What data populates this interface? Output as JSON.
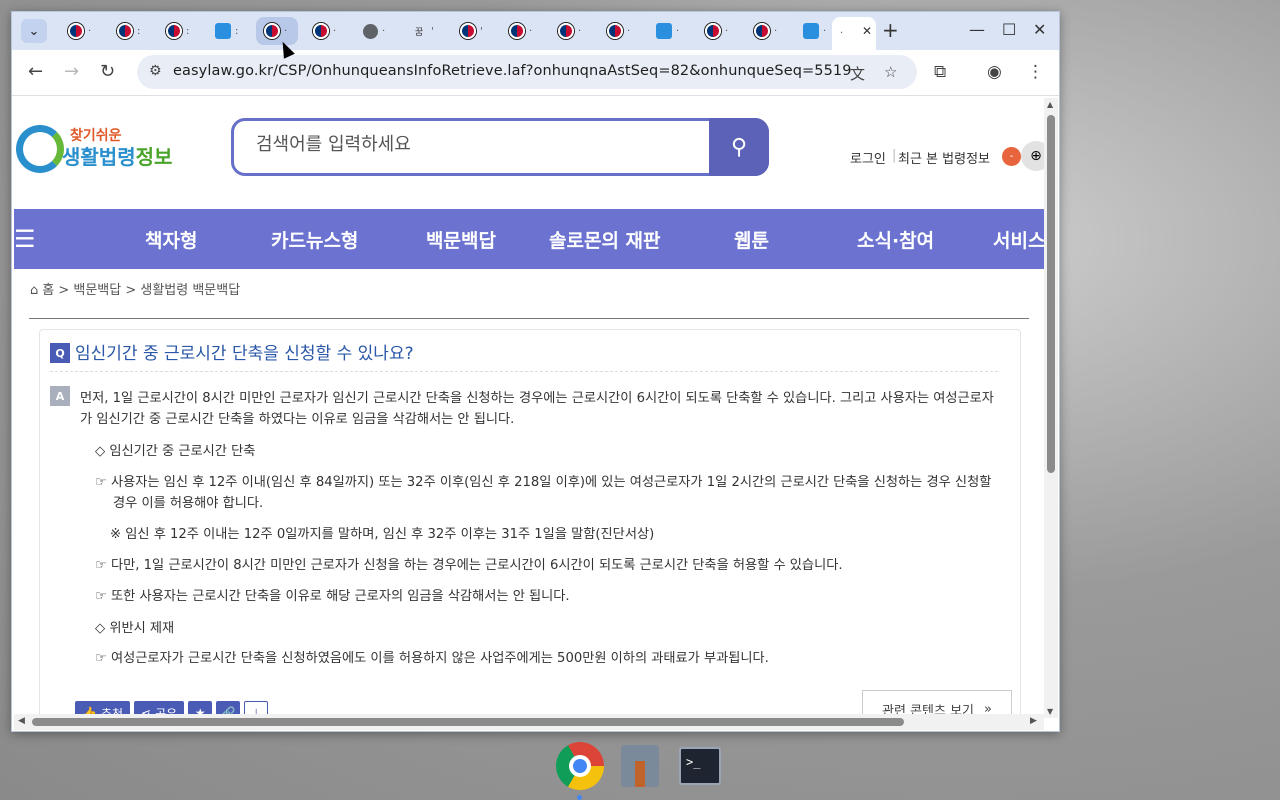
{
  "browser": {
    "tabs": [
      {
        "favicon": "korea-gov-icon",
        "dot": "·"
      },
      {
        "favicon": "korea-gov-icon",
        "dot": ":"
      },
      {
        "favicon": "korea-gov-icon",
        "dot": ":"
      },
      {
        "favicon": "easylaw-box-icon",
        "dot": ":"
      },
      {
        "favicon": "korea-gov-icon",
        "dot": "·"
      },
      {
        "favicon": "korea-gov-icon",
        "dot": "·"
      },
      {
        "favicon": "globe-icon",
        "dot": "·"
      },
      {
        "favicon": "text-favicon",
        "dot": "'"
      },
      {
        "favicon": "korea-gov-icon",
        "dot": "'"
      },
      {
        "favicon": "korea-gov-icon",
        "dot": "·"
      },
      {
        "favicon": "korea-gov-icon",
        "dot": "·"
      },
      {
        "favicon": "korea-gov-icon",
        "dot": "·"
      },
      {
        "favicon": "easylaw-box-icon",
        "dot": "·"
      },
      {
        "favicon": "korea-gov-icon",
        "dot": "·"
      },
      {
        "favicon": "korea-gov-icon",
        "dot": "·"
      },
      {
        "favicon": "easylaw-box-icon",
        "dot": "·"
      }
    ],
    "tab_glyph": "꿈",
    "active_tab_dot": "·",
    "close_glyph": "✕",
    "newtab_glyph": "+",
    "url": "easylaw.go.kr/CSP/OnhunqueansInfoRetrieve.laf?onhunqnaAstSeq=82&onhunqueSeq=5519"
  },
  "site": {
    "logo_top": "찾기쉬운",
    "logo_main_a": "생활법령",
    "logo_main_b": "정보",
    "search_placeholder": "검색어를 입력하세요",
    "login": "로그인",
    "recent": "최근 본 법령정보",
    "recent_badge": "-",
    "menu": [
      "책자형",
      "카드뉴스형",
      "백문백답",
      "솔로몬의 재판",
      "웹툰",
      "소식·참여",
      "서비스"
    ],
    "breadcrumb": "홈 > 백문백답 > 생활법령 백문백답"
  },
  "qa": {
    "q_label": "Q",
    "question": "임신기간 중 근로시간 단축을 신청할 수 있나요?",
    "a_label": "A",
    "answer": "먼저, 1일 근로시간이 8시간 미만인 근로자가 임신기 근로시간 단축을 신청하는 경우에는 근로시간이 6시간이 되도록 단축할 수 있습니다. 그리고 사용자는 여성근로자가 임신기간 중 근로시간 단축을 하였다는 이유로 임금을 삭감해서는 안 됩니다.",
    "section1": "◇ 임신기간 중 근로시간 단축",
    "item1": "☞ 사용자는 임신 후 12주 이내(임신 후 84일까지) 또는 32주 이후(임신 후 218일 이후)에 있는 여성근로자가 1일 2시간의 근로시간 단축을 신청하는 경우 신청할 경우 이를 허용해야 합니다.",
    "note1": "※ 임신 후 12주 이내는 12주 0일까지를 말하며, 임신 후 32주 이후는 31주 1일을 말함(진단서상)",
    "item2": "☞ 다만, 1일 근로시간이 8시간 미만인 근로자가 신청을 하는 경우에는 근로시간이 6시간이 되도록 근로시간 단축을 허용할 수 있습니다.",
    "item3": "☞ 또한 사용자는 근로시간 단축을 이유로 해당 근로자의 임금을 삭감해서는 안 됩니다.",
    "section2": "◇ 위반시 제재",
    "item4": "☞ 여성근로자가 근로시간 단축을 신청하였음에도 이를 허용하지 않은 사업주에게는 500만원 이하의 과태료가 부과됩니다.",
    "recommend": "추천",
    "share": "공유",
    "related": "관련 콘텐츠 보기"
  }
}
